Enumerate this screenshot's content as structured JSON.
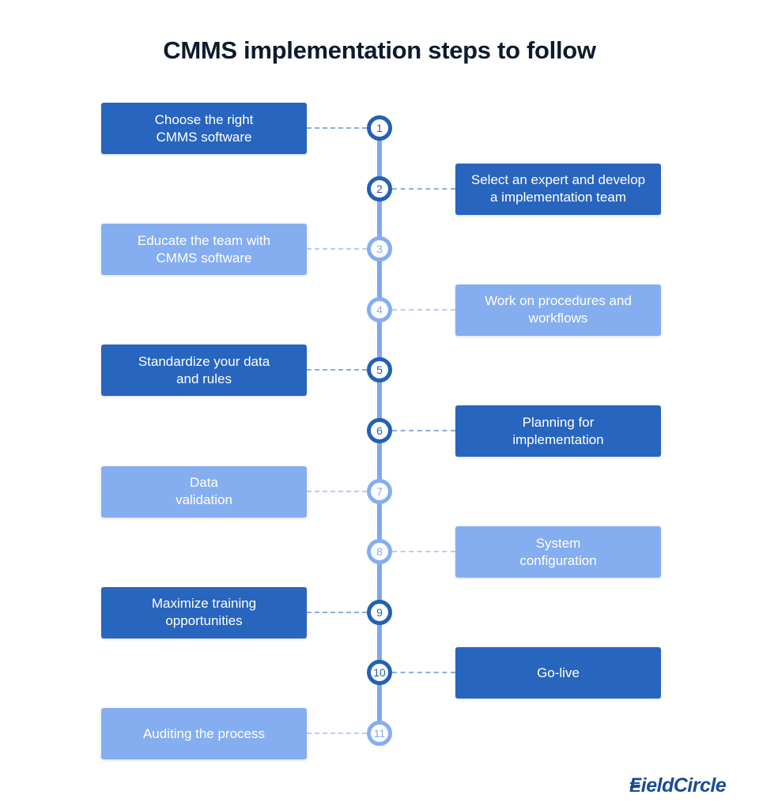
{
  "title": "CMMS implementation steps to follow",
  "colors": {
    "dark": "#2865be",
    "light": "#85aef0",
    "spine": "#7fa8ea",
    "title": "#0d1b2e"
  },
  "steps": [
    {
      "number": "1",
      "label": "Choose the right\nCMMS software",
      "side": "left",
      "shade": "dark"
    },
    {
      "number": "2",
      "label": "Select an expert and develop\na implementation team",
      "side": "right",
      "shade": "dark"
    },
    {
      "number": "3",
      "label": "Educate the team with\nCMMS software",
      "side": "left",
      "shade": "light"
    },
    {
      "number": "4",
      "label": "Work on procedures and\nworkflows",
      "side": "right",
      "shade": "light"
    },
    {
      "number": "5",
      "label": "Standardize your data\nand rules",
      "side": "left",
      "shade": "dark"
    },
    {
      "number": "6",
      "label": "Planning for\nimplementation",
      "side": "right",
      "shade": "dark"
    },
    {
      "number": "7",
      "label": "Data\nvalidation",
      "side": "left",
      "shade": "light"
    },
    {
      "number": "8",
      "label": "System\nconfiguration",
      "side": "right",
      "shade": "light"
    },
    {
      "number": "9",
      "label": "Maximize training\nopportunities",
      "side": "left",
      "shade": "dark"
    },
    {
      "number": "10",
      "label": "Go-live",
      "side": "right",
      "shade": "dark"
    },
    {
      "number": "11",
      "label": "Auditing the process",
      "side": "left",
      "shade": "light"
    }
  ],
  "logo": {
    "text": "FieldCircle"
  }
}
